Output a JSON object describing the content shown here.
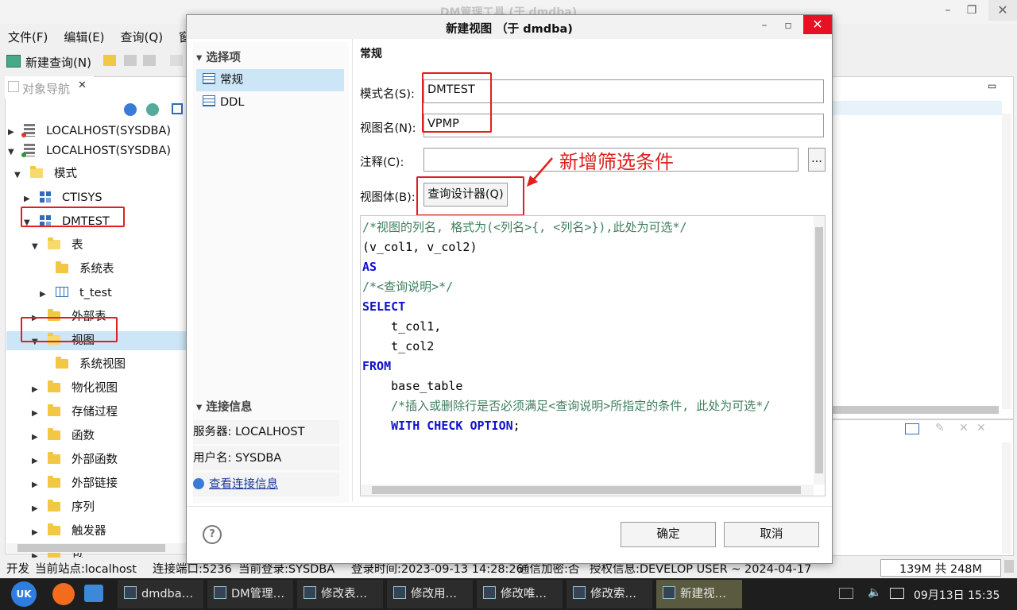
{
  "main_window": {
    "title": "DM管理工具 (于 dmdba)",
    "menu": [
      "文件(F)",
      "编辑(E)",
      "查询(Q)",
      "窗"
    ],
    "toolbar_new_query": "新建查询(N)"
  },
  "navigator": {
    "tab_label": "对象导航",
    "tree": [
      {
        "label": "LOCALHOST(SYSDBA)",
        "level": 0,
        "kind": "server-red",
        "expanded": false
      },
      {
        "label": "LOCALHOST(SYSDBA)",
        "level": 0,
        "kind": "server-green",
        "expanded": true
      },
      {
        "label": "模式",
        "level": 1,
        "kind": "folder-open",
        "expanded": true
      },
      {
        "label": "CTISYS",
        "level": 2,
        "kind": "schema",
        "expanded": false
      },
      {
        "label": "DMTEST",
        "level": 2,
        "kind": "schema",
        "expanded": true
      },
      {
        "label": "表",
        "level": 3,
        "kind": "folder-open",
        "expanded": true
      },
      {
        "label": "系统表",
        "level": 4,
        "kind": "folder",
        "expanded": null
      },
      {
        "label": "t_test",
        "level": 4,
        "kind": "table",
        "expanded": false
      },
      {
        "label": "外部表",
        "level": 3,
        "kind": "folder",
        "expanded": false
      },
      {
        "label": "视图",
        "level": 3,
        "kind": "folder-open",
        "expanded": true
      },
      {
        "label": "系统视图",
        "level": 4,
        "kind": "folder",
        "expanded": null
      },
      {
        "label": "物化视图",
        "level": 3,
        "kind": "folder",
        "expanded": false
      },
      {
        "label": "存储过程",
        "level": 3,
        "kind": "folder",
        "expanded": false
      },
      {
        "label": "函数",
        "level": 3,
        "kind": "folder",
        "expanded": false
      },
      {
        "label": "外部函数",
        "level": 3,
        "kind": "folder",
        "expanded": false
      },
      {
        "label": "外部链接",
        "level": 3,
        "kind": "folder",
        "expanded": false
      },
      {
        "label": "序列",
        "level": 3,
        "kind": "folder",
        "expanded": false
      },
      {
        "label": "触发器",
        "level": 3,
        "kind": "folder",
        "expanded": false
      },
      {
        "label": "包",
        "level": 3,
        "kind": "folder",
        "expanded": false
      }
    ]
  },
  "dialog": {
    "title": "新建视图 （于 dmdba)",
    "options_header": "选择项",
    "options": [
      "常规",
      "DDL"
    ],
    "conn_header": "连接信息",
    "server_row": "服务器: LOCALHOST",
    "user_row": "用户名: SYSDBA",
    "view_conn_link": "查看连接信息",
    "section_title": "常规",
    "schema_label": "模式名(S):",
    "schema_value": "DMTEST",
    "view_label": "视图名(N):",
    "view_value": "VPMP",
    "comment_label": "注释(C):",
    "comment_value": "",
    "ellipsis": "...",
    "body_label": "视图体(B):",
    "designer_button": "查询设计器(Q)",
    "annotation": "新增筛选条件",
    "code": [
      {
        "parts": [
          {
            "t": "/*视图的列名, 格式为(<列名>{, <列名>}),此处为可选*/",
            "c": "cmt"
          }
        ]
      },
      {
        "parts": [
          {
            "t": "(v_col1, v_col2)",
            "c": "plain"
          }
        ]
      },
      {
        "parts": [
          {
            "t": "AS",
            "c": "kw"
          }
        ]
      },
      {
        "parts": [
          {
            "t": "/*<查询说明>*/",
            "c": "cmt"
          }
        ]
      },
      {
        "parts": [
          {
            "t": "SELECT",
            "c": "kw"
          }
        ]
      },
      {
        "parts": [
          {
            "t": "    t_col1,",
            "c": "plain"
          }
        ]
      },
      {
        "parts": [
          {
            "t": "    t_col2",
            "c": "plain"
          }
        ]
      },
      {
        "parts": [
          {
            "t": "FROM",
            "c": "kw"
          }
        ]
      },
      {
        "parts": [
          {
            "t": "    base_table",
            "c": "plain"
          }
        ]
      },
      {
        "parts": [
          {
            "t": "    /*插入或删除行是否必须满足<查询说明>所指定的条件, 此处为可选*/",
            "c": "cmt"
          }
        ]
      },
      {
        "parts": [
          {
            "t": "    ",
            "c": "plain"
          },
          {
            "t": "WITH CHECK OPTION",
            "c": "kw"
          },
          {
            "t": ";",
            "c": "plain"
          }
        ]
      }
    ],
    "ok_button": "确定",
    "cancel_button": "取消",
    "help": "?"
  },
  "statusbar": {
    "mode": "开发",
    "site": "当前站点:localhost",
    "port": "连接端口:5236",
    "login": "当前登录:SYSDBA",
    "login_time": "登录时间:2023-09-13 14:28:26",
    "encrypt": "通信加密:否",
    "license": "授权信息:DEVELOP USER ~ 2024-04-17",
    "memory": "139M 共 248M"
  },
  "taskbar": {
    "tasks": [
      "dmdba…",
      "DM管理…",
      "修改表…",
      "修改用…",
      "修改唯…",
      "修改索…",
      "新建视…"
    ],
    "clock": "09月13日 15:35"
  },
  "colors": {
    "accent": "#e02020",
    "selection": "#cde6f7",
    "keyword": "#1010d0",
    "comment": "#3f7f5f",
    "close": "#e81123"
  }
}
